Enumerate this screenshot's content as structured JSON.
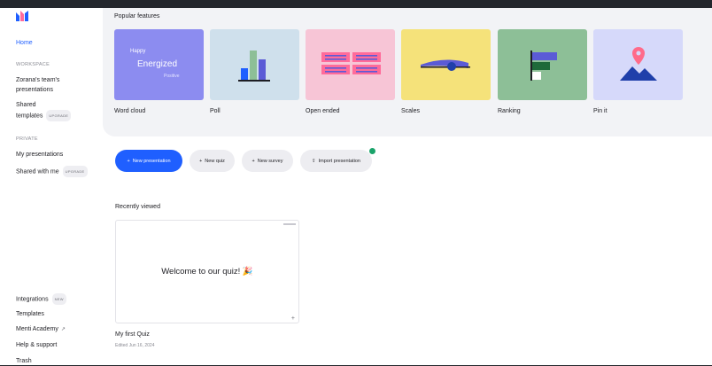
{
  "sidebar": {
    "home": "Home",
    "workspace_label": "WORKSPACE",
    "workspace_items": [
      "Zorana's team's",
      "presentations"
    ],
    "shared_templates": [
      "Shared",
      "templates"
    ],
    "shared_templates_badge": "UPGRADE",
    "private_label": "PRIVATE",
    "my_presentations": "My presentations",
    "shared_with_me": "Shared with me",
    "shared_with_me_badge": "UPGRADE",
    "integrations": "Integrations",
    "integrations_badge": "NEW",
    "templates": "Templates",
    "menti_academy": "Menti Academy",
    "help_support": "Help & support",
    "trash": "Trash"
  },
  "features": {
    "title": "Popular features",
    "cards": [
      {
        "label": "Word cloud",
        "color": "#8c8cf0",
        "words": [
          "Happy",
          "Energized",
          "Positive"
        ]
      },
      {
        "label": "Poll",
        "color": "#cfe0ec"
      },
      {
        "label": "Open ended",
        "color": "#f7c5d6"
      },
      {
        "label": "Scales",
        "color": "#f5e27a"
      },
      {
        "label": "Ranking",
        "color": "#8dbf97"
      },
      {
        "label": "Pin it",
        "color": "#d6d9fa"
      }
    ]
  },
  "actions": {
    "new_presentation": "New presentation",
    "new_quiz": "New quiz",
    "new_survey": "New survey",
    "import_presentation": "Import presentation"
  },
  "recent": {
    "title": "Recently viewed",
    "slide_text": "Welcome to our quiz! 🎉",
    "name": "My first Quiz",
    "edited": "Edited Jun 16, 2024"
  },
  "colors": {
    "accent": "#1f5fff",
    "brand": "#1f5fff"
  }
}
